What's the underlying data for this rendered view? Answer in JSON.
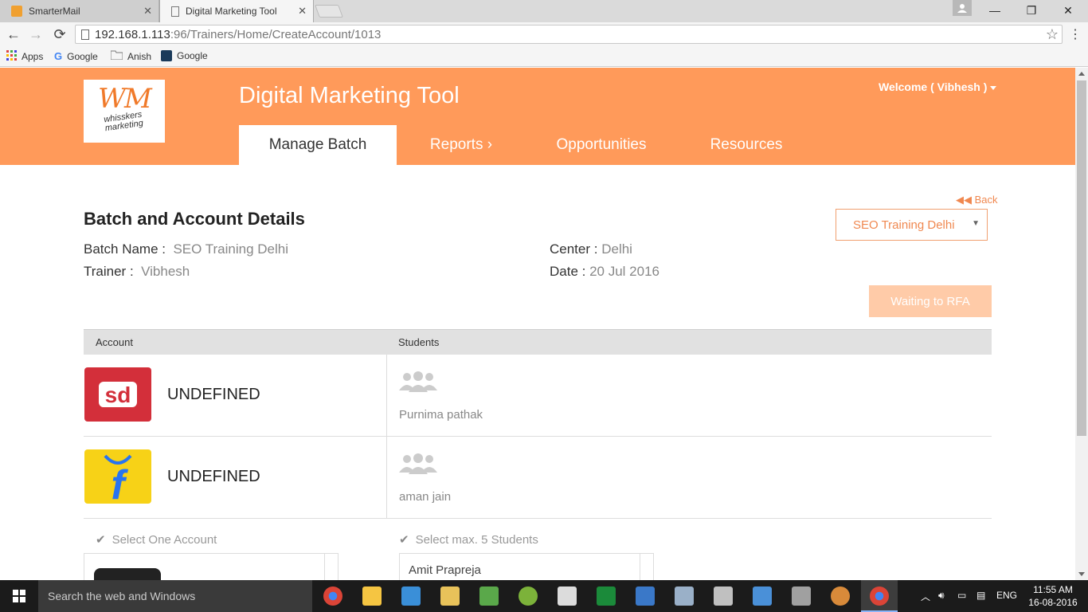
{
  "browser": {
    "tabs": [
      {
        "title": "SmarterMail",
        "active": false
      },
      {
        "title": "Digital Marketing Tool",
        "active": true
      }
    ],
    "url_host": "192.168.1.113",
    "url_path": ":96/Trainers/Home/CreateAccount/1013",
    "bookmarks": [
      {
        "label": "Apps",
        "icon": "apps-grid-icon"
      },
      {
        "label": "Google",
        "icon": "google-icon"
      },
      {
        "label": "Anish",
        "icon": "folder-icon"
      },
      {
        "label": "Google",
        "icon": "bookmark-site-icon"
      }
    ]
  },
  "header": {
    "logo_mark": "WM",
    "logo_text_1": "whisskers",
    "logo_text_2": "marketing",
    "title": "Digital Marketing Tool",
    "welcome": "Welcome ( Vibhesh )",
    "nav": [
      {
        "label": "Manage Batch",
        "active": true
      },
      {
        "label": "Reports ›",
        "active": false
      },
      {
        "label": "Opportunities",
        "active": false
      },
      {
        "label": "Resources",
        "active": false
      }
    ],
    "bg_color": "#ff9a5a"
  },
  "details": {
    "back_label": "Back",
    "section_title": "Batch and Account Details",
    "batch_name_label": "Batch Name :",
    "batch_name": "SEO Training Delhi",
    "trainer_label": "Trainer :",
    "trainer": "Vibhesh",
    "center_label": "Center :",
    "center": "Delhi",
    "date_label": "Date :",
    "date": "20 Jul 2016",
    "batch_select_value": "SEO Training Delhi",
    "rfa_button": "Waiting to RFA"
  },
  "table": {
    "headers": [
      "Account",
      "Students"
    ],
    "rows": [
      {
        "account": "UNDEFINED",
        "logo": "snapdeal-logo",
        "logo_text": "sd",
        "student": "Purnima pathak"
      },
      {
        "account": "UNDEFINED",
        "logo": "flipkart-logo",
        "logo_text": "f",
        "student": "aman jain"
      }
    ]
  },
  "selection": {
    "account_hint": "Select One Account",
    "students_hint": "Select max. 5 Students",
    "student_options": [
      "Amit Prapreja"
    ]
  },
  "taskbar": {
    "search_placeholder": "Search the web and Windows",
    "language": "ENG",
    "time": "11:55 AM",
    "date": "16-08-2016"
  }
}
